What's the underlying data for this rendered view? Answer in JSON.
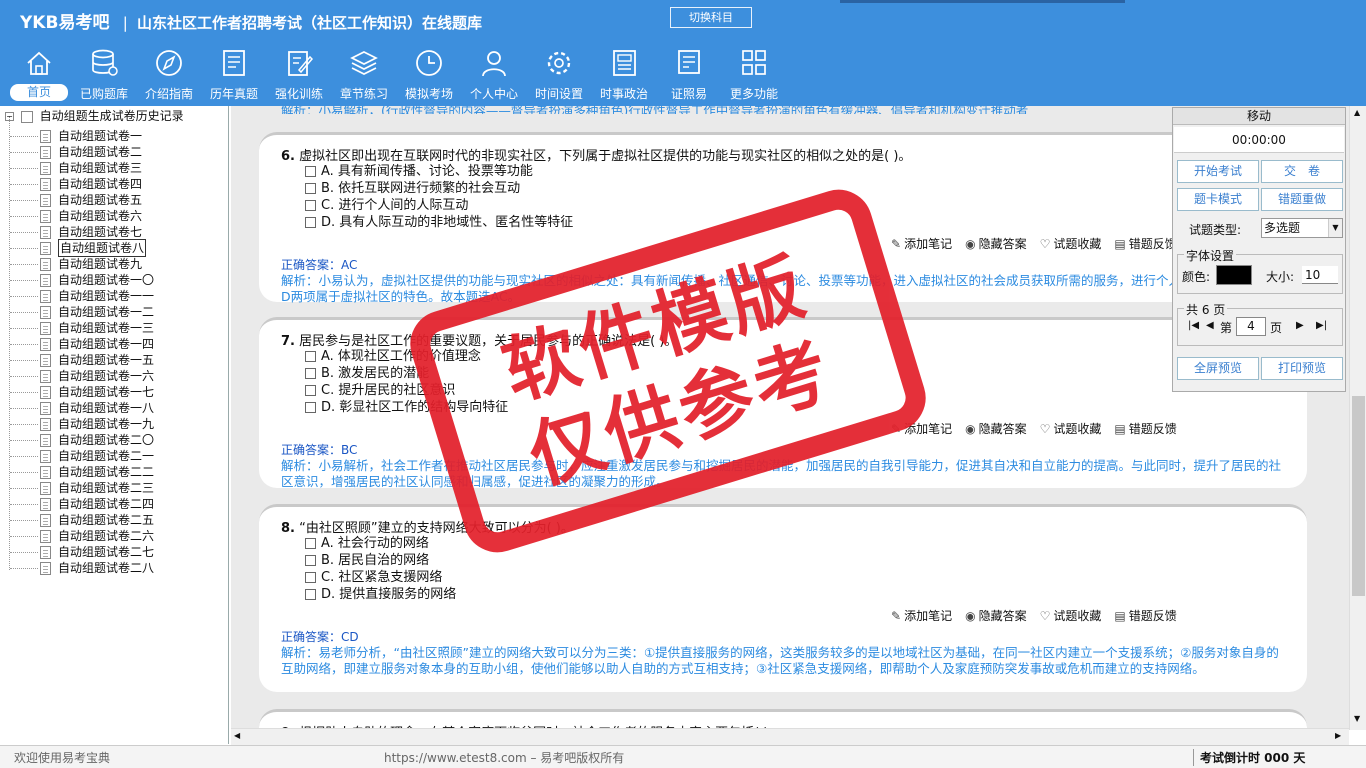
{
  "header": {
    "logo": "YKB易考吧",
    "separator": "|",
    "title": "山东社区工作者招聘考试（社区工作知识）在线题库",
    "switch_label": "切换科目"
  },
  "nav": [
    {
      "label": "首页",
      "icon": "home-icon"
    },
    {
      "label": "已购题库",
      "icon": "database-icon"
    },
    {
      "label": "介绍指南",
      "icon": "compass-icon"
    },
    {
      "label": "历年真题",
      "icon": "document-list-icon"
    },
    {
      "label": "强化训练",
      "icon": "edit-document-icon"
    },
    {
      "label": "章节练习",
      "icon": "layers-icon"
    },
    {
      "label": "模拟考场",
      "icon": "clock-icon"
    },
    {
      "label": "个人中心",
      "icon": "user-icon"
    },
    {
      "label": "时间设置",
      "icon": "gear-icon"
    },
    {
      "label": "时事政治",
      "icon": "newspaper-icon"
    },
    {
      "label": "证照易",
      "icon": "certificate-icon"
    },
    {
      "label": "更多功能",
      "icon": "grid-icon"
    }
  ],
  "tree": {
    "root": "自动组题生成试卷历史记录",
    "toggle": "−",
    "items": [
      "自动组题试卷一",
      "自动组题试卷二",
      "自动组题试卷三",
      "自动组题试卷四",
      "自动组题试卷五",
      "自动组题试卷六",
      "自动组题试卷七",
      "自动组题试卷八",
      "自动组题试卷九",
      "自动组题试卷一〇",
      "自动组题试卷一一",
      "自动组题试卷一二",
      "自动组题试卷一三",
      "自动组题试卷一四",
      "自动组题试卷一五",
      "自动组题试卷一六",
      "自动组题试卷一七",
      "自动组题试卷一八",
      "自动组题试卷一九",
      "自动组题试卷二〇",
      "自动组题试卷二一",
      "自动组题试卷二二",
      "自动组题试卷二三",
      "自动组题试卷二四",
      "自动组题试卷二五",
      "自动组题试卷二六",
      "自动组题试卷二七",
      "自动组题试卷二八"
    ],
    "selected_index": 7
  },
  "top_partial": "解析：小易解析，(行政性督导的内容——督导者扮演多种角色)行政性督导工作中督导者扮演的角色有缓冲器、倡导者和机构变迁推动者",
  "questions": [
    {
      "number": "6.",
      "stem": "虚拟社区即出现在互联网时代的非现实社区，下列属于虚拟社区提供的功能与现实社区的相似之处的是( )。",
      "options": [
        "A. 具有新闻传播、讨论、投票等功能",
        "B. 依托互联网进行频繁的社会互动",
        "C. 进行个人间的人际互动",
        "D. 具有人际互动的非地域性、匿名性等特征"
      ],
      "answer": "正确答案：AC",
      "analysis": "解析：小易认为，虚拟社区提供的功能与现实社区的相似之处：具有新闻传播、社区通信、讨论、投票等功能，进入虚拟社区的社会成员获取所需的服务，进行个人间的人际互动。B、D两项属于虚拟社区的特色。故本题选AC。"
    },
    {
      "number": "7.",
      "stem": "居民参与是社区工作的重要议题，关于居民参与的正确说法是( )。",
      "options": [
        "A. 体现社区工作的价值理念",
        "B. 激发居民的潜能",
        "C. 提升居民的社区意识",
        "D. 彰显社区工作的结构导向特征"
      ],
      "answer": "正确答案：BC",
      "analysis": "解析：小易解析，社会工作者在推动社区居民参与时，应注重激发居民参与和挖掘居民的潜能，加强居民的自我引导能力，促进其自决和自立能力的提高。与此同时，提升了居民的社区意识，增强居民的社区认同感和归属感，促进社区的凝聚力的形成。"
    },
    {
      "number": "8.",
      "stem": "“由社区照顾”建立的支持网络大致可以分为( )。",
      "options": [
        "A. 社会行动的网络",
        "B. 居民自治的网络",
        "C. 社区紧急支援网络",
        "D. 提供直接服务的网络"
      ],
      "answer": "正确答案：CD",
      "analysis": "解析：易老师分析，“由社区照顾”建立的网络大致可以分为三类：①提供直接服务的网络，这类服务较多的是以地域社区为基础，在同一社区内建立一个支援系统；②服务对象自身的互助网络，即建立服务对象本身的互助小组，使他们能够以助人自助的方式互相支持；③社区紧急支援网络，即帮助个人及家庭预防突发事故或危机而建立的支持网络。"
    },
    {
      "number": "9.",
      "stem": "根据助人自助的理念，在某个家庭面临贫困时，社会工作者的服务内容主要包括( )。"
    }
  ],
  "actions": {
    "note": "添加笔记",
    "hide": "隐藏答案",
    "fav": "试题收藏",
    "feedback": "错题反馈"
  },
  "panel": {
    "title": "移动",
    "timer": "00:00:00",
    "start": "开始考试",
    "submit": "交　卷",
    "card_mode": "题卡模式",
    "redo": "错题重做",
    "type_label": "试题类型:",
    "type_value": "多选题",
    "font_legend": "字体设置",
    "color_label": "颜色:",
    "color_value": "#000000",
    "size_label": "大小:",
    "size_value": "10",
    "pages_legend": "共 6 页",
    "page_prefix": "第",
    "page_value": "4",
    "page_suffix": "页",
    "fullscreen": "全屏预览",
    "print": "打印预览"
  },
  "status": {
    "welcome": "欢迎使用易考宝典",
    "url": "https://www.etest8.com – 易考吧版权所有",
    "countdown": "考试倒计时 000 天"
  },
  "watermark": {
    "line1": "软件模版",
    "line2": "仅供参考"
  }
}
